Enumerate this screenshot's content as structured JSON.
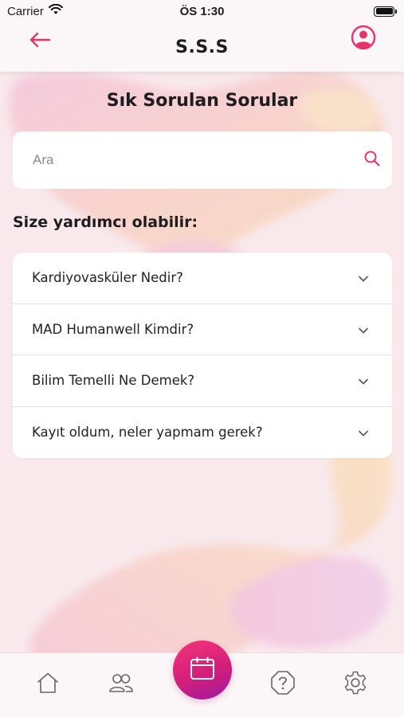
{
  "status_bar": {
    "carrier": "Carrier",
    "time": "ÖS 1:30"
  },
  "nav": {
    "title": "S.S.S",
    "back_icon": "arrow-left-icon",
    "profile_icon": "user-circle-icon"
  },
  "page": {
    "heading": "Sık Sorulan Sorular"
  },
  "search": {
    "placeholder": "Ara",
    "value": "",
    "icon": "search-icon"
  },
  "help_section": {
    "title": "Size yardımcı olabilir:"
  },
  "faq": [
    {
      "question": "Kardiyovasküler Nedir?"
    },
    {
      "question": "MAD Humanwell Kimdir?"
    },
    {
      "question": "Bilim Temelli Ne Demek?"
    },
    {
      "question": "Kayıt oldum, neler yapmam gerek?"
    }
  ],
  "tab_bar": {
    "items": [
      {
        "icon": "home-icon"
      },
      {
        "icon": "users-icon"
      },
      {
        "icon": "calendar-icon"
      },
      {
        "icon": "help-octagon-icon"
      },
      {
        "icon": "gear-icon"
      }
    ]
  },
  "colors": {
    "accent": "#e8336d",
    "fab_start": "#f2367a",
    "fab_end": "#9a1ba0"
  }
}
